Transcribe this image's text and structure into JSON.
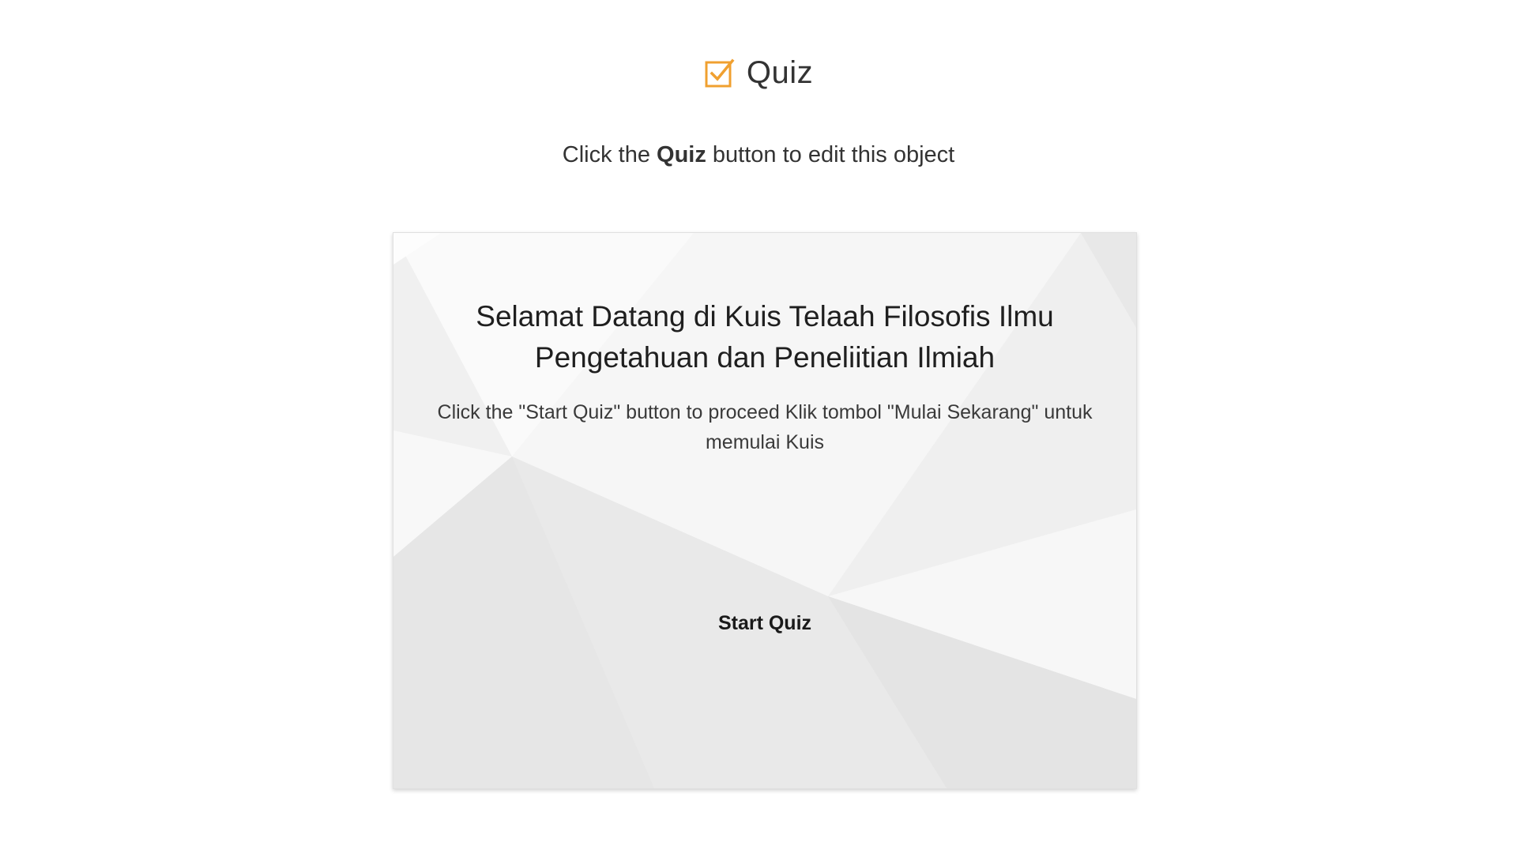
{
  "header": {
    "title": "Quiz",
    "icon": "checkbox-check-icon",
    "icon_color": "#f0a030"
  },
  "instruction": {
    "prefix": "Click the ",
    "bold": "Quiz",
    "suffix": " button to edit this object"
  },
  "quiz_card": {
    "title": "Selamat Datang di Kuis Telaah Filosofis Ilmu Pengetahuan dan Peneliitian Ilmiah",
    "subtitle": "Click the \"Start Quiz\" button to proceed Klik tombol \"Mulai Sekarang\" untuk memulai Kuis",
    "start_button_label": "Start Quiz"
  }
}
